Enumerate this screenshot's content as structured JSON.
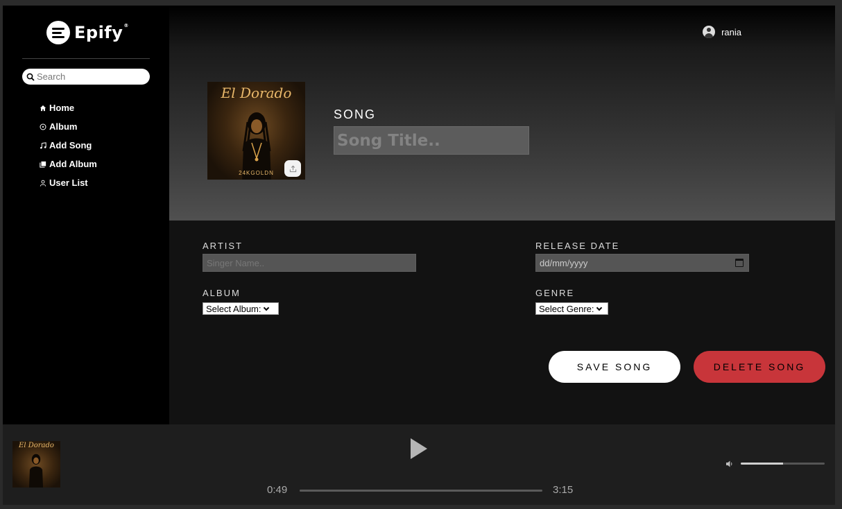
{
  "brand": {
    "name": "Epify",
    "mark": "®"
  },
  "sidebar": {
    "search_placeholder": "Search",
    "items": [
      {
        "label": "Home",
        "icon": "home-icon"
      },
      {
        "label": "Album",
        "icon": "disc-icon"
      },
      {
        "label": "Add Song",
        "icon": "music-note-icon"
      },
      {
        "label": "Add Album",
        "icon": "album-stack-icon"
      },
      {
        "label": "User List",
        "icon": "user-icon"
      }
    ]
  },
  "header": {
    "username": "rania"
  },
  "cover": {
    "title": "El Dorado",
    "subtitle": "24KGOLDN"
  },
  "song": {
    "label": "SONG",
    "title_placeholder": "Song Title.."
  },
  "form": {
    "artist_label": "ARTIST",
    "artist_placeholder": "Singer Name..",
    "release_label": "RELEASE DATE",
    "release_placeholder": "dd/mm/yyyy",
    "album_label": "ALBUM",
    "album_selected": "Select Album:",
    "genre_label": "GENRE",
    "genre_selected": "Select Genre:"
  },
  "actions": {
    "save_label": "SAVE SONG",
    "delete_label": "DELETE SONG"
  },
  "player": {
    "current_time": "0:49",
    "duration": "3:15",
    "thumb_title": "El Dorado",
    "volume_fraction": 0.5
  },
  "colors": {
    "delete": "#c8353a",
    "accent_gold": "#e9b86a"
  }
}
